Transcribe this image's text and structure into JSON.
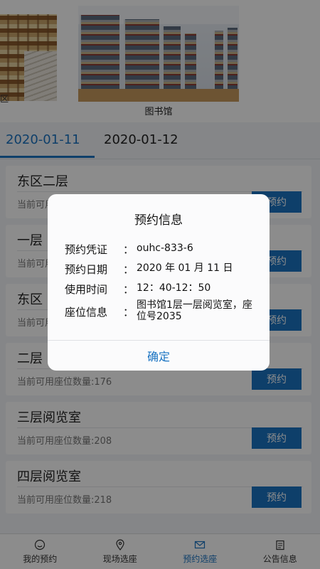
{
  "carousel": {
    "left_caption": "区",
    "main_caption": "图书馆"
  },
  "tabs": [
    {
      "label": "2020-01-11",
      "active": true
    },
    {
      "label": "2020-01-12",
      "active": false
    }
  ],
  "rooms": [
    {
      "name": "东区二层",
      "count": "当前可用座位数量:",
      "button": "预约"
    },
    {
      "name": "一层",
      "count": "当前可用座位数量:",
      "button": "预约"
    },
    {
      "name": "东区",
      "count": "当前可用座位数量:",
      "button": "预约"
    },
    {
      "name": "二层",
      "count": "当前可用座位数量:176",
      "button": "预约"
    },
    {
      "name": "三层阅览室",
      "count": "当前可用座位数量:208",
      "button": "预约"
    },
    {
      "name": "四层阅览室",
      "count": "当前可用座位数量:218",
      "button": "预约"
    }
  ],
  "nav": [
    {
      "label": "我的预约",
      "icon": "smile-icon",
      "active": false
    },
    {
      "label": "现场选座",
      "icon": "location-pin-icon",
      "active": false
    },
    {
      "label": "预约选座",
      "icon": "envelope-icon",
      "active": true
    },
    {
      "label": "公告信息",
      "icon": "notepad-icon",
      "active": false
    }
  ],
  "dialog": {
    "title": "预约信息",
    "rows": [
      {
        "key": "预约凭证",
        "colon": "：",
        "value": "ouhc-833-6"
      },
      {
        "key": "预约日期",
        "colon": "：",
        "value": "2020 年 01 月 11 日"
      },
      {
        "key": "使用时间",
        "colon": "：",
        "value": "12：40-12：50"
      },
      {
        "key": "座位信息",
        "colon": "：",
        "value": "图书馆1层一层阅览室，座位号2035"
      }
    ],
    "confirm": "确定"
  },
  "colors": {
    "accent": "#1a73c2",
    "overlay": "rgba(0,0,0,0.45)"
  }
}
